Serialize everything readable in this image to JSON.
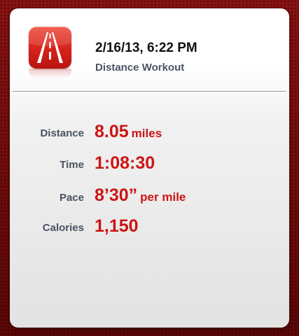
{
  "workout": {
    "date_time": "2/16/13, 6:22 PM",
    "type": "Distance Workout",
    "icon": "road-icon"
  },
  "stats": {
    "distance": {
      "label": "Distance",
      "value": "8.05",
      "unit": "miles"
    },
    "time": {
      "label": "Time",
      "value": "1:08:30"
    },
    "pace": {
      "label": "Pace",
      "value": "8’30”",
      "unit": "per mile"
    },
    "calories": {
      "label": "Calories",
      "value": "1,150"
    }
  },
  "colors": {
    "accent": "#cc1414",
    "label": "#4a5260",
    "background": "#6e0a0a",
    "icon": "#d4221a"
  }
}
